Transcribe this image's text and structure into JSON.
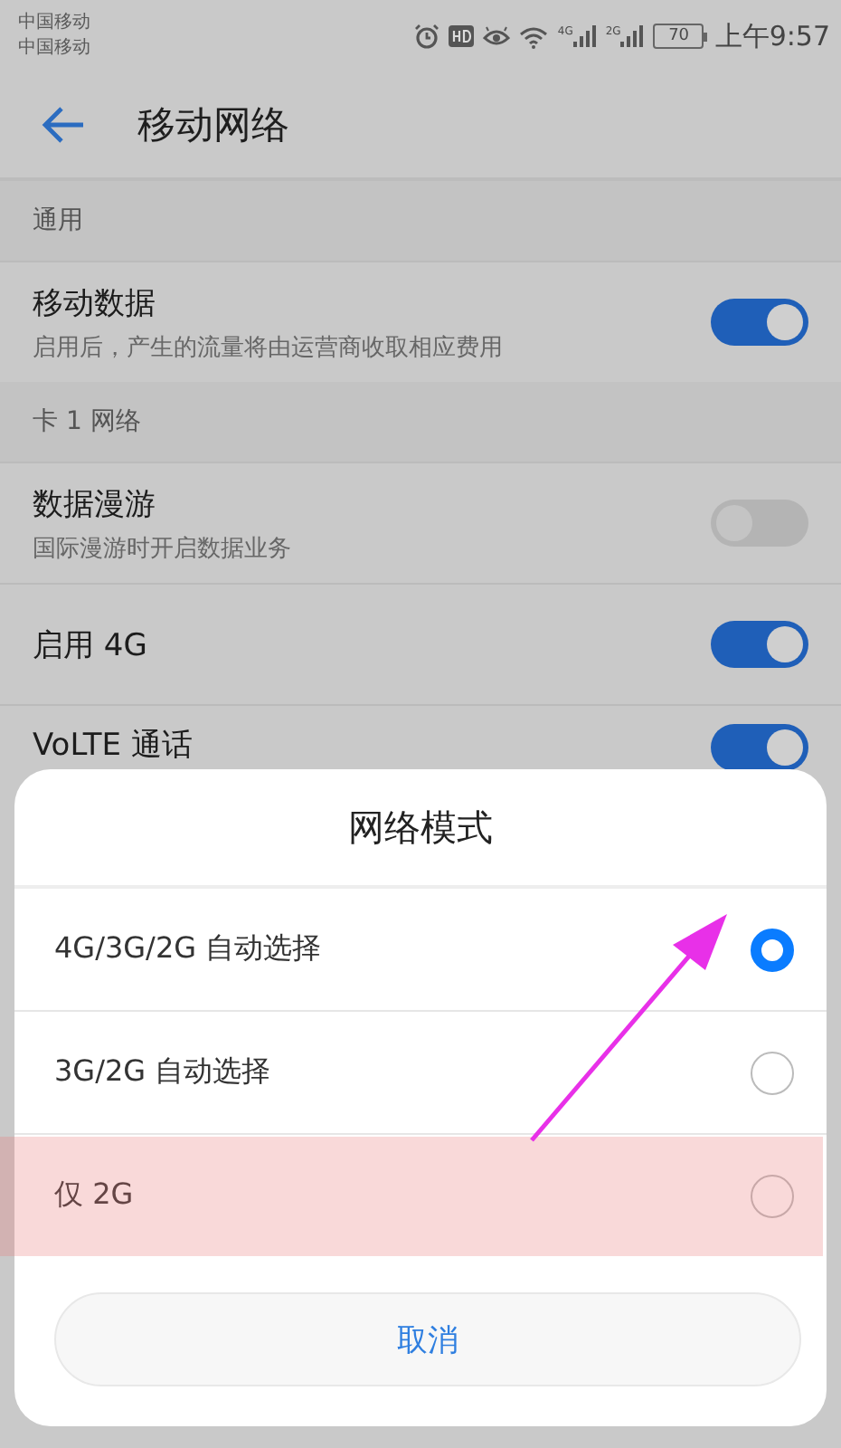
{
  "status_bar": {
    "carriers": [
      "中国移动",
      "中国移动"
    ],
    "signals": [
      {
        "label": "4G"
      },
      {
        "label": "2G"
      }
    ],
    "battery": "70",
    "time": "上午9:57"
  },
  "header": {
    "title": "移动网络"
  },
  "sections": [
    {
      "title": "通用",
      "items": [
        {
          "title": "移动数据",
          "subtitle": "启用后，产生的流量将由运营商收取相应费用",
          "on": true
        }
      ]
    },
    {
      "title": "卡 1 网络",
      "items": [
        {
          "title": "数据漫游",
          "subtitle": "国际漫游时开启数据业务",
          "on": false
        },
        {
          "title": "启用 4G",
          "on": true
        },
        {
          "title": "VoLTE 通话",
          "on": true
        }
      ]
    }
  ],
  "dialog": {
    "title": "网络模式",
    "options": [
      {
        "label": "4G/3G/2G 自动选择",
        "selected": true
      },
      {
        "label": "3G/2G 自动选择",
        "selected": false
      },
      {
        "label": "仅 2G",
        "selected": false
      }
    ],
    "cancel": "取消"
  }
}
